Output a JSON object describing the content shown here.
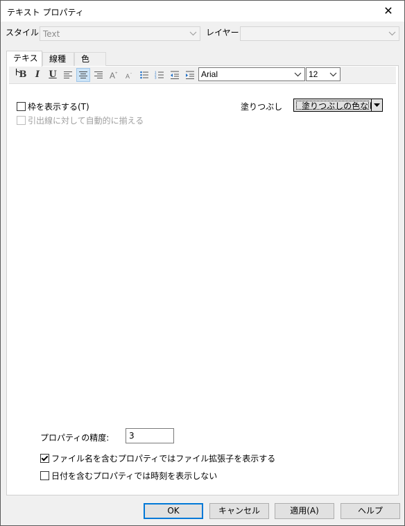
{
  "window": {
    "title": "テキスト プロパティ",
    "close_glyph": "✕"
  },
  "style_row": {
    "style_label": "スタイル:",
    "style_value": "Text",
    "layer_label": "レイヤー:",
    "layer_value": ""
  },
  "tabs": [
    {
      "label": "テキスト",
      "active": true
    },
    {
      "label": "線種",
      "active": false
    },
    {
      "label": "色",
      "active": false
    }
  ],
  "toolbar": {
    "bold": "B",
    "italic": "I",
    "underline": "U",
    "font_family": "Arial",
    "font_size": "12",
    "pressed_button": "align-center"
  },
  "text_tab": {
    "show_frame_label": "枠を表示する(T)",
    "show_frame_checked": false,
    "align_leader_label": "引出線に対して自動的に揃える",
    "align_leader_checked": false,
    "align_leader_enabled": false,
    "fill_label": "塗りつぶし",
    "fill_value": "塗りつぶしの色なし",
    "precision_label": "プロパティの精度:",
    "precision_value": "3",
    "show_ext_label": "ファイル名を含むプロパティではファイル拡張子を表示する",
    "show_ext_checked": true,
    "hide_time_label": "日付を含むプロパティでは時刻を表示しない",
    "hide_time_checked": false
  },
  "buttons": {
    "ok": "OK",
    "cancel": "キャンセル",
    "apply": "適用(A)",
    "help": "ヘルプ"
  },
  "colors": {
    "dialog_bg": "#f0f0f0",
    "default_button_border": "#0078d7",
    "pressed_tool_bg": "#cce4f7"
  }
}
